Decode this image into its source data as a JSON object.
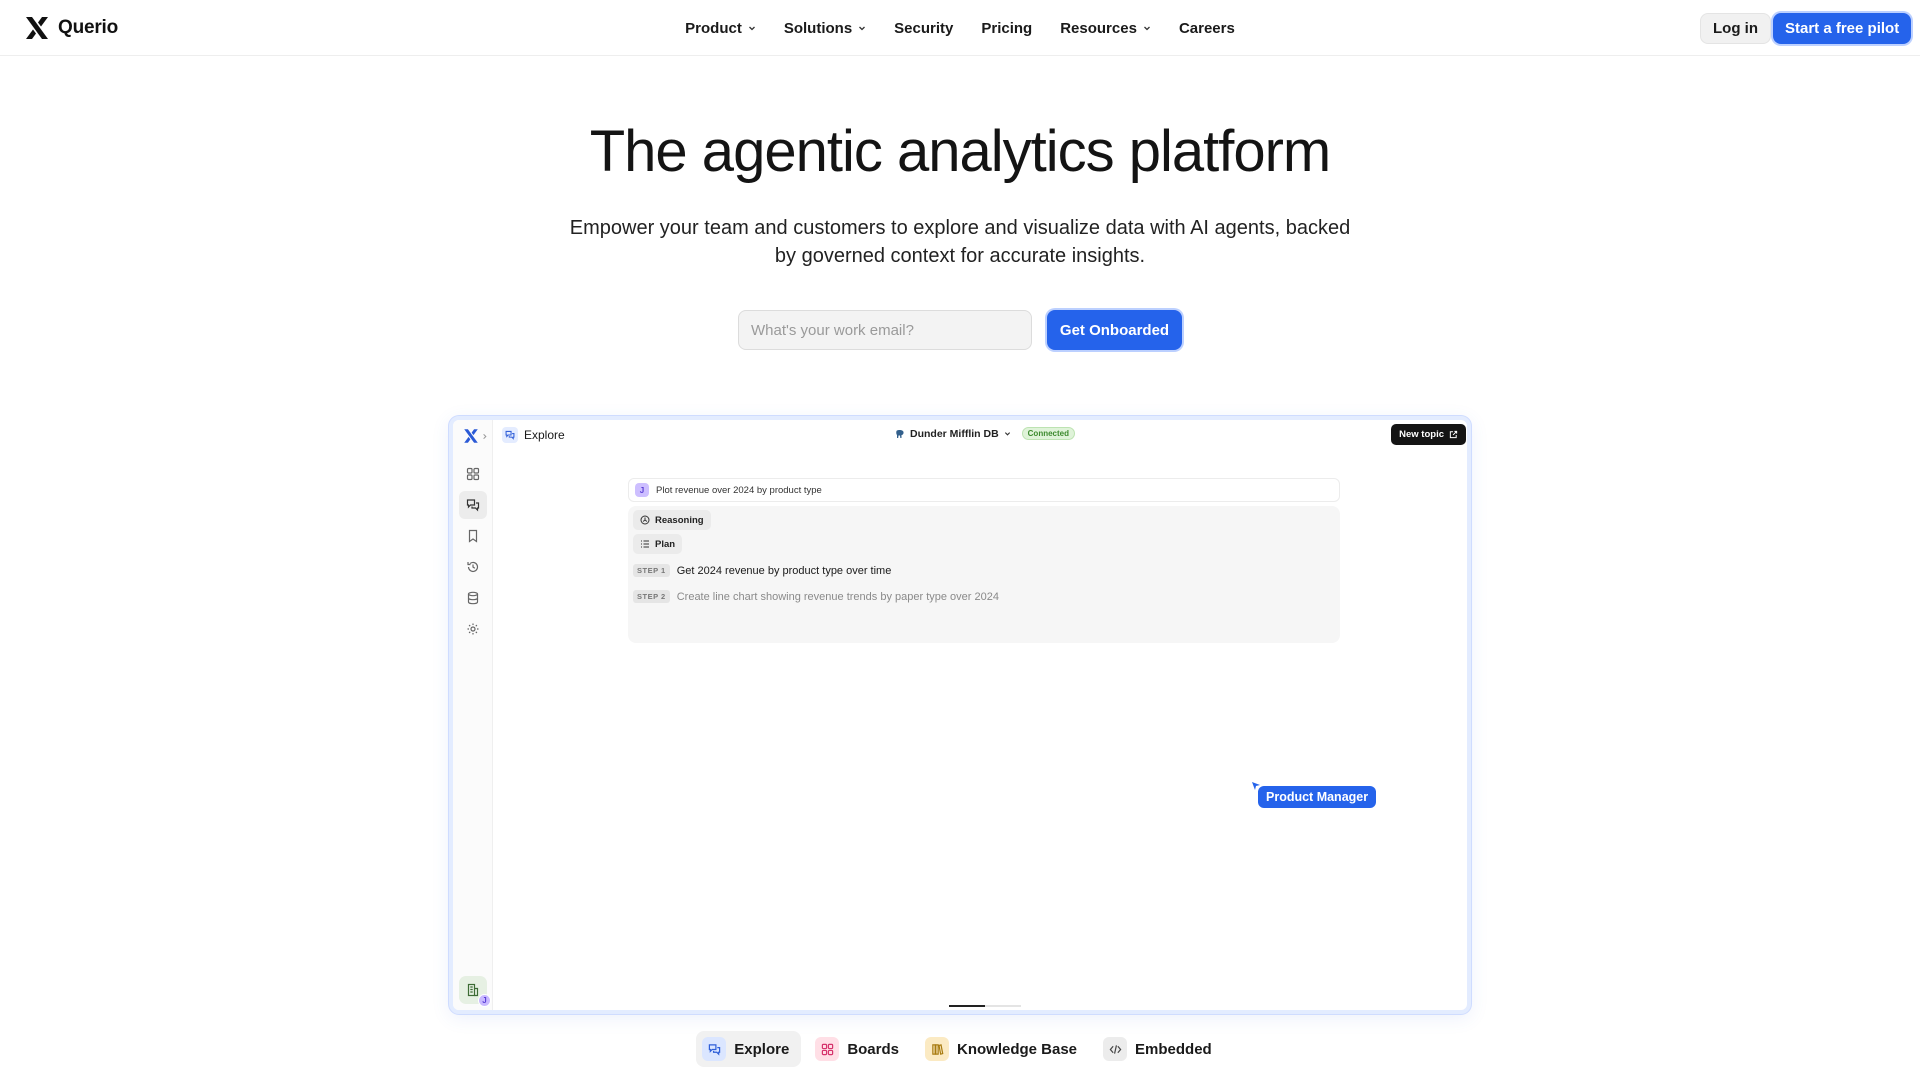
{
  "nav": {
    "logo_text": "Querio",
    "menu": [
      {
        "label": "Product",
        "dropdown": true
      },
      {
        "label": "Solutions",
        "dropdown": true
      },
      {
        "label": "Security",
        "dropdown": false
      },
      {
        "label": "Pricing",
        "dropdown": false
      },
      {
        "label": "Resources",
        "dropdown": true
      },
      {
        "label": "Careers",
        "dropdown": false
      }
    ],
    "login_label": "Log in",
    "pilot_label": "Start a free pilot"
  },
  "hero": {
    "title": "The agentic analytics platform",
    "subtitle": "Empower your team and customers to explore and visualize data with AI agents, backed by governed context for accurate insights.",
    "email_placeholder": "What's your work email?",
    "cta_label": "Get Onboarded"
  },
  "app": {
    "breadcrumb": "Explore",
    "db_name": "Dunder Mifflin DB",
    "db_status": "Connected",
    "new_topic_label": "New topic",
    "user_initial": "J",
    "prompt": "Plot revenue over 2024 by product type",
    "reasoning_label": "Reasoning",
    "plan_label": "Plan",
    "steps": [
      {
        "tag": "STEP 1",
        "text": "Get 2024 revenue by product type over time"
      },
      {
        "tag": "STEP 2",
        "text": "Create line chart showing revenue trends by paper type over 2024"
      }
    ],
    "cursor_label": "Product Manager",
    "carousel_progress": 0.5
  },
  "tabs": [
    {
      "label": "Explore",
      "icon": "chat-icon",
      "color": "#dbe6ff",
      "active": true
    },
    {
      "label": "Boards",
      "icon": "grid-icon",
      "color": "#ffdfe6",
      "active": false
    },
    {
      "label": "Knowledge Base",
      "icon": "books-icon",
      "color": "#fbeac3",
      "active": false
    },
    {
      "label": "Embedded",
      "icon": "code-icon",
      "color": "#ececec",
      "active": false
    }
  ],
  "colors": {
    "brand_blue": "#2563eb",
    "connected_green": "#3c8a2e",
    "text_dark": "#141414"
  }
}
